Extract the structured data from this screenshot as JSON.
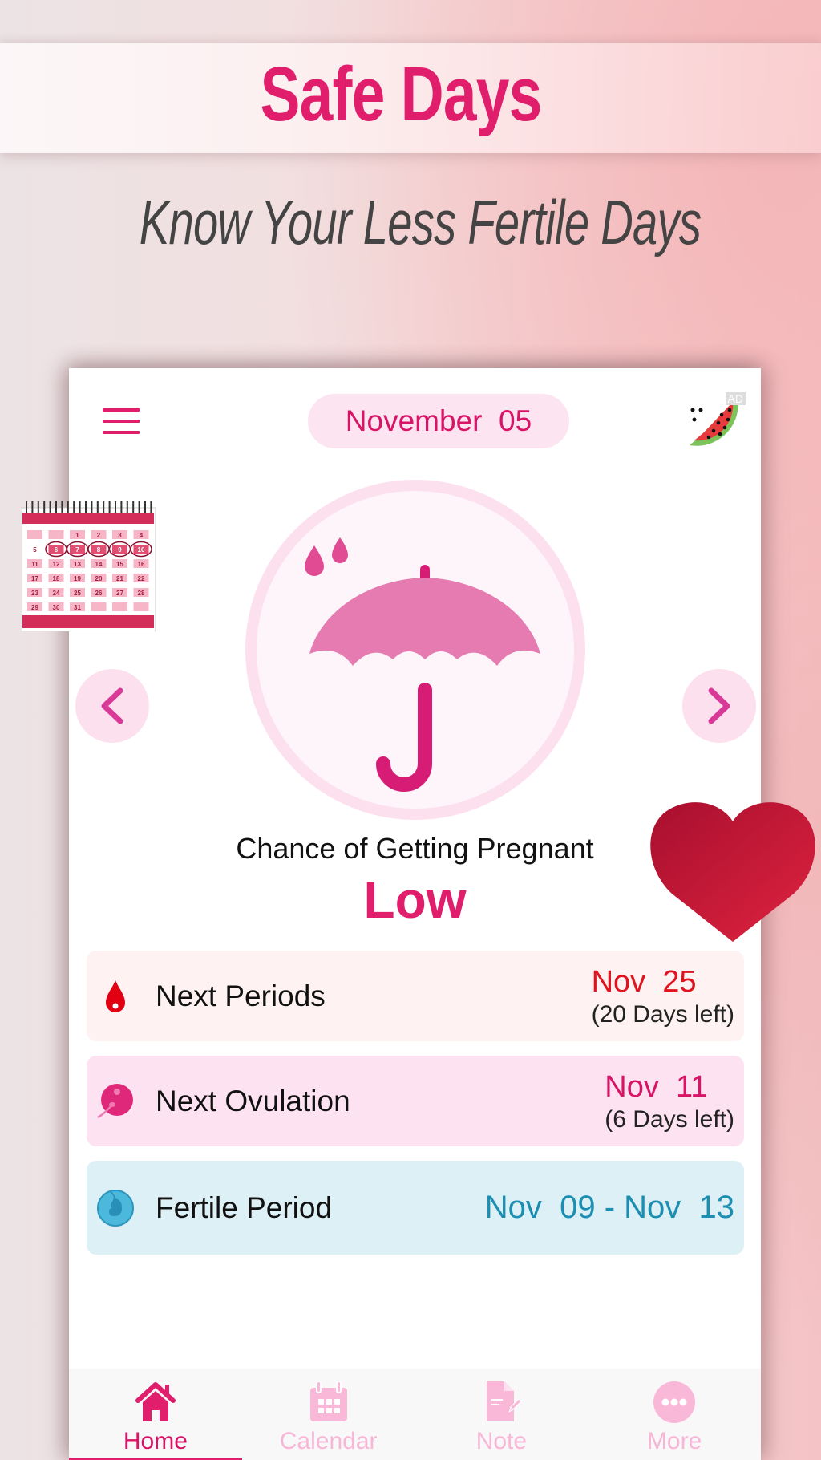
{
  "promo": {
    "title": "Safe Days",
    "subtitle": "Know Your Less Fertile Days"
  },
  "header": {
    "date": "November  05",
    "menu_icon": "hamburger-menu-icon",
    "ad_icon": "watermelon-ad-icon",
    "ad_badge": "AD"
  },
  "main": {
    "illustration": "umbrella-rain-icon",
    "chance_label": "Chance of Getting Pregnant",
    "chance_value": "Low",
    "prev_icon": "chevron-left-icon",
    "next_icon": "chevron-right-icon"
  },
  "rows": [
    {
      "label": "Next Periods",
      "icon": "blood-drop-icon",
      "date": "Nov  25",
      "days_left": "(20 Days left)",
      "date_color": "#e0141e"
    },
    {
      "label": "Next Ovulation",
      "icon": "ovum-icon",
      "date": "Nov  11",
      "days_left": "(6 Days left)",
      "date_color": "#d81466"
    },
    {
      "label": "Fertile Period",
      "icon": "embryo-icon",
      "range": "Nov  09 - Nov  13",
      "date_color": "#1c8eb2"
    }
  ],
  "tabs": [
    {
      "label": "Home",
      "icon": "home-icon",
      "active": true
    },
    {
      "label": "Calendar",
      "icon": "calendar-icon",
      "active": false
    },
    {
      "label": "Note",
      "icon": "note-icon",
      "active": false
    },
    {
      "label": "More",
      "icon": "more-icon",
      "active": false
    }
  ],
  "decorations": {
    "calendar_days": [
      "",
      "",
      "1",
      "2",
      "3",
      "4",
      "5",
      "6",
      "7",
      "8",
      "9",
      "10",
      "11",
      "12",
      "13",
      "14",
      "15",
      "16",
      "17",
      "18",
      "19",
      "20",
      "21",
      "22",
      "23",
      "24",
      "25",
      "26",
      "27",
      "28",
      "29",
      "30",
      "31",
      "",
      "",
      ""
    ],
    "circled_days": [
      "6",
      "7",
      "8",
      "9",
      "10"
    ]
  },
  "colors": {
    "brand": "#e01e6c",
    "accent_light": "#fde0ee",
    "period": "#e0141e",
    "ovulation": "#d81466",
    "fertile": "#1c8eb2",
    "tab_inactive": "#f7b6d6"
  }
}
